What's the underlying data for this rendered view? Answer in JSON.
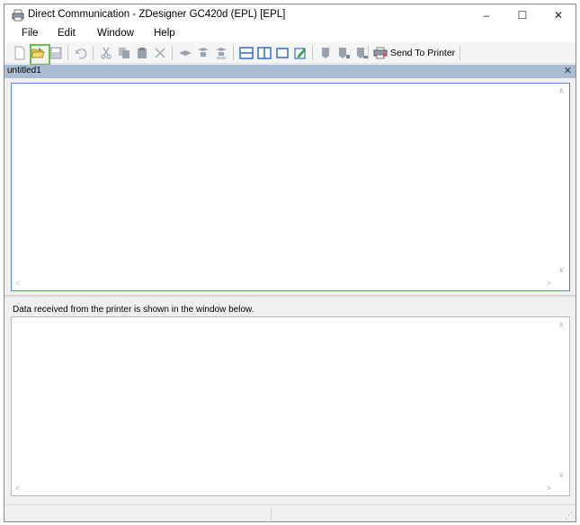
{
  "window": {
    "title": "Direct Communication - ZDesigner GC420d (EPL) [EPL]",
    "controls": {
      "minimize": "–",
      "maximize": "☐",
      "close": "✕"
    }
  },
  "menu": {
    "items": [
      "File",
      "Edit",
      "Window",
      "Help"
    ]
  },
  "toolbar": {
    "send_label": "Send To Printer",
    "icons": [
      "new-file-icon",
      "open-file-icon",
      "save-icon",
      "undo-icon",
      "cut-icon",
      "copy-icon",
      "paste-icon",
      "delete-icon",
      "send-file-icon",
      "send-string-icon",
      "send-command-icon",
      "split-horizontal-icon",
      "split-vertical-icon",
      "single-view-icon",
      "properties-icon",
      "printer-config-icon",
      "printer-status-icon",
      "printer-info-icon",
      "send-to-printer-icon"
    ]
  },
  "document": {
    "tab_title": "untitled1",
    "close": "✕",
    "content": ""
  },
  "received": {
    "label": "Data received from the printer is shown in the window below.",
    "content": ""
  },
  "colors": {
    "highlight": "#6cc04a",
    "tab_bg": "#a9bdd3",
    "editor_border": "#4a8ad6"
  }
}
